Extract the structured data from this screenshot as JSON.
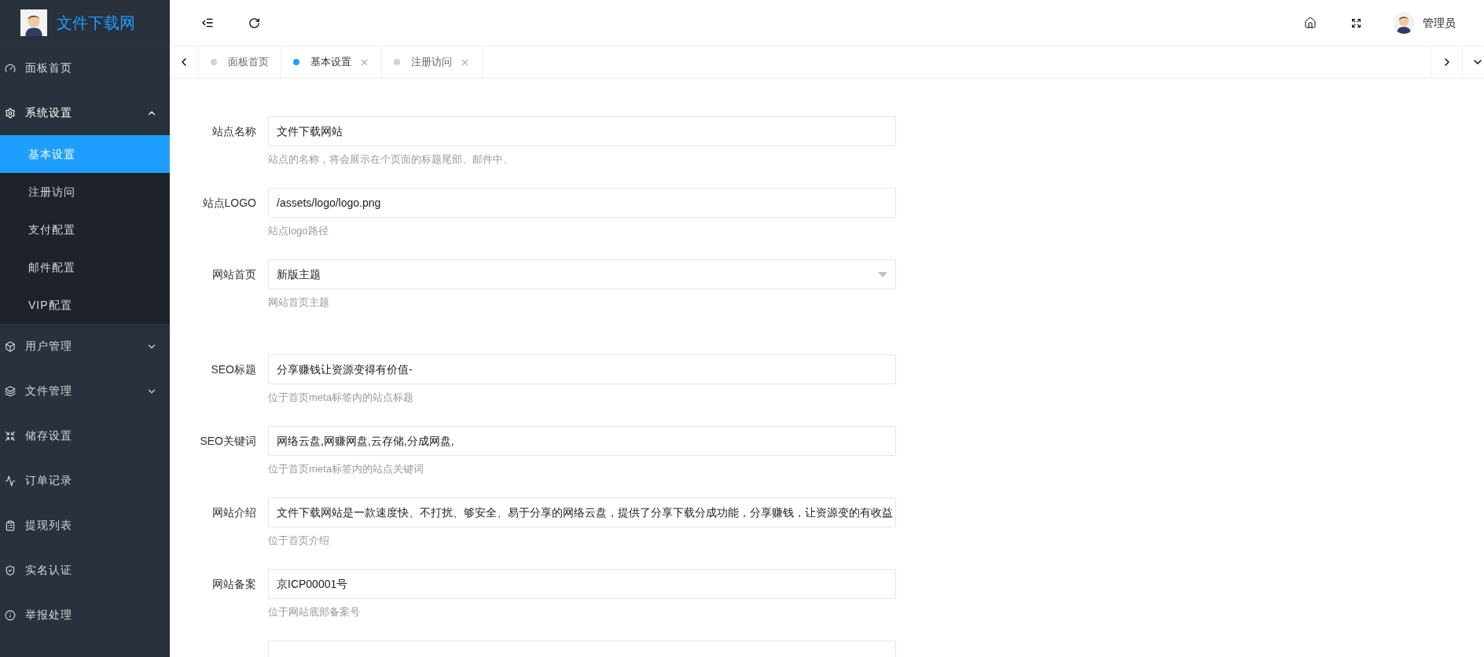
{
  "brand": {
    "name": "文件下载网"
  },
  "sidebar": {
    "items": [
      {
        "label": "面板首页",
        "kind": "link",
        "expanded": false
      },
      {
        "label": "系统设置",
        "kind": "group",
        "expanded": true,
        "children": [
          {
            "label": "基本设置",
            "selected": true
          },
          {
            "label": "注册访问",
            "selected": false
          },
          {
            "label": "支付配置",
            "selected": false
          },
          {
            "label": "邮件配置",
            "selected": false
          },
          {
            "label": "VIP配置",
            "selected": false
          }
        ]
      },
      {
        "label": "用户管理",
        "kind": "group",
        "expanded": false
      },
      {
        "label": "文件管理",
        "kind": "group",
        "expanded": false
      },
      {
        "label": "储存设置",
        "kind": "link",
        "expanded": false
      },
      {
        "label": "订单记录",
        "kind": "link",
        "expanded": false
      },
      {
        "label": "提现列表",
        "kind": "link",
        "expanded": false
      },
      {
        "label": "实名认证",
        "kind": "link",
        "expanded": false
      },
      {
        "label": "举报处理",
        "kind": "link",
        "expanded": false
      }
    ]
  },
  "header": {
    "user": "管理员"
  },
  "tabs": [
    {
      "label": "面板首页",
      "selected": false,
      "closable": false
    },
    {
      "label": "基本设置",
      "selected": true,
      "closable": true
    },
    {
      "label": "注册访问",
      "selected": false,
      "closable": true
    }
  ],
  "form": {
    "sections": [
      {
        "fields": [
          {
            "label": "站点名称",
            "kind": "text",
            "value": "文件下载网站",
            "help": "站点的名称，将会展示在个页面的标题尾部、邮件中。"
          },
          {
            "label": "站点LOGO",
            "kind": "text",
            "value": "/assets/logo/logo.png",
            "help": "站点logo路径"
          },
          {
            "label": "网站首页",
            "kind": "select",
            "value": "新版主题",
            "help": "网站首页主题"
          }
        ]
      },
      {
        "fields": [
          {
            "label": "SEO标题",
            "kind": "text",
            "value": "分享赚钱让资源变得有价值-",
            "help": "位于首页meta标签内的站点标题"
          },
          {
            "label": "SEO关键词",
            "kind": "text",
            "value": "网络云盘,网赚网盘,云存储,分成网盘,",
            "help": "位于首页meta标签内的站点关键词"
          },
          {
            "label": "网站介绍",
            "kind": "text",
            "value": "文件下载网站是一款速度快、不打扰、够安全、易于分享的网络云盘，提供了分享下载分成功能，分享赚钱，让资源变的有收益",
            "help": "位于首页介绍"
          },
          {
            "label": "网站备案",
            "kind": "text",
            "value": "京ICP00001号",
            "help": "位于网站底部备案号"
          }
        ]
      }
    ]
  }
}
